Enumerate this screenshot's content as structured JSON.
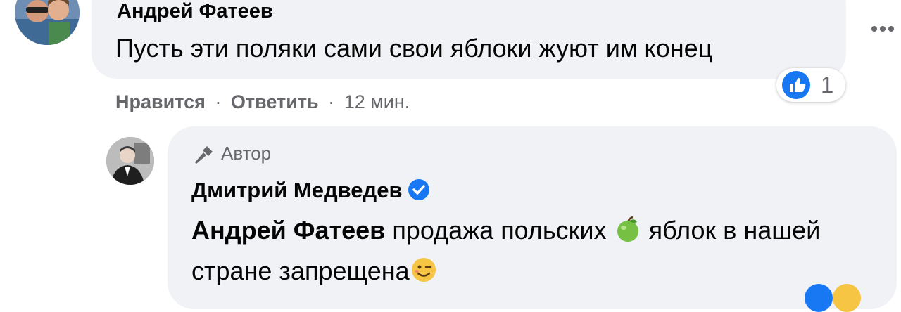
{
  "comment": {
    "author": "Андрей Фатеев",
    "text": "Пусть эти поляки сами свои яблоки жуют им конец",
    "reaction_count": "1",
    "actions": {
      "like": "Нравится",
      "reply": "Ответить",
      "sep": "·",
      "time": "12 мин."
    }
  },
  "reply": {
    "badge": "Автор",
    "author": "Дмитрий Медведев",
    "mention": "Андрей Фатеев",
    "text_part1": "продажа польских",
    "text_part2": "яблок в нашей стране запрещена"
  },
  "colors": {
    "bubble": "#f0f2f5",
    "facebook_blue": "#1877f2",
    "secondary_text": "#65676b"
  },
  "icons": [
    "more-icon",
    "like-icon",
    "microphone-icon",
    "verified-icon",
    "green-apple-icon",
    "winking-face-icon"
  ]
}
